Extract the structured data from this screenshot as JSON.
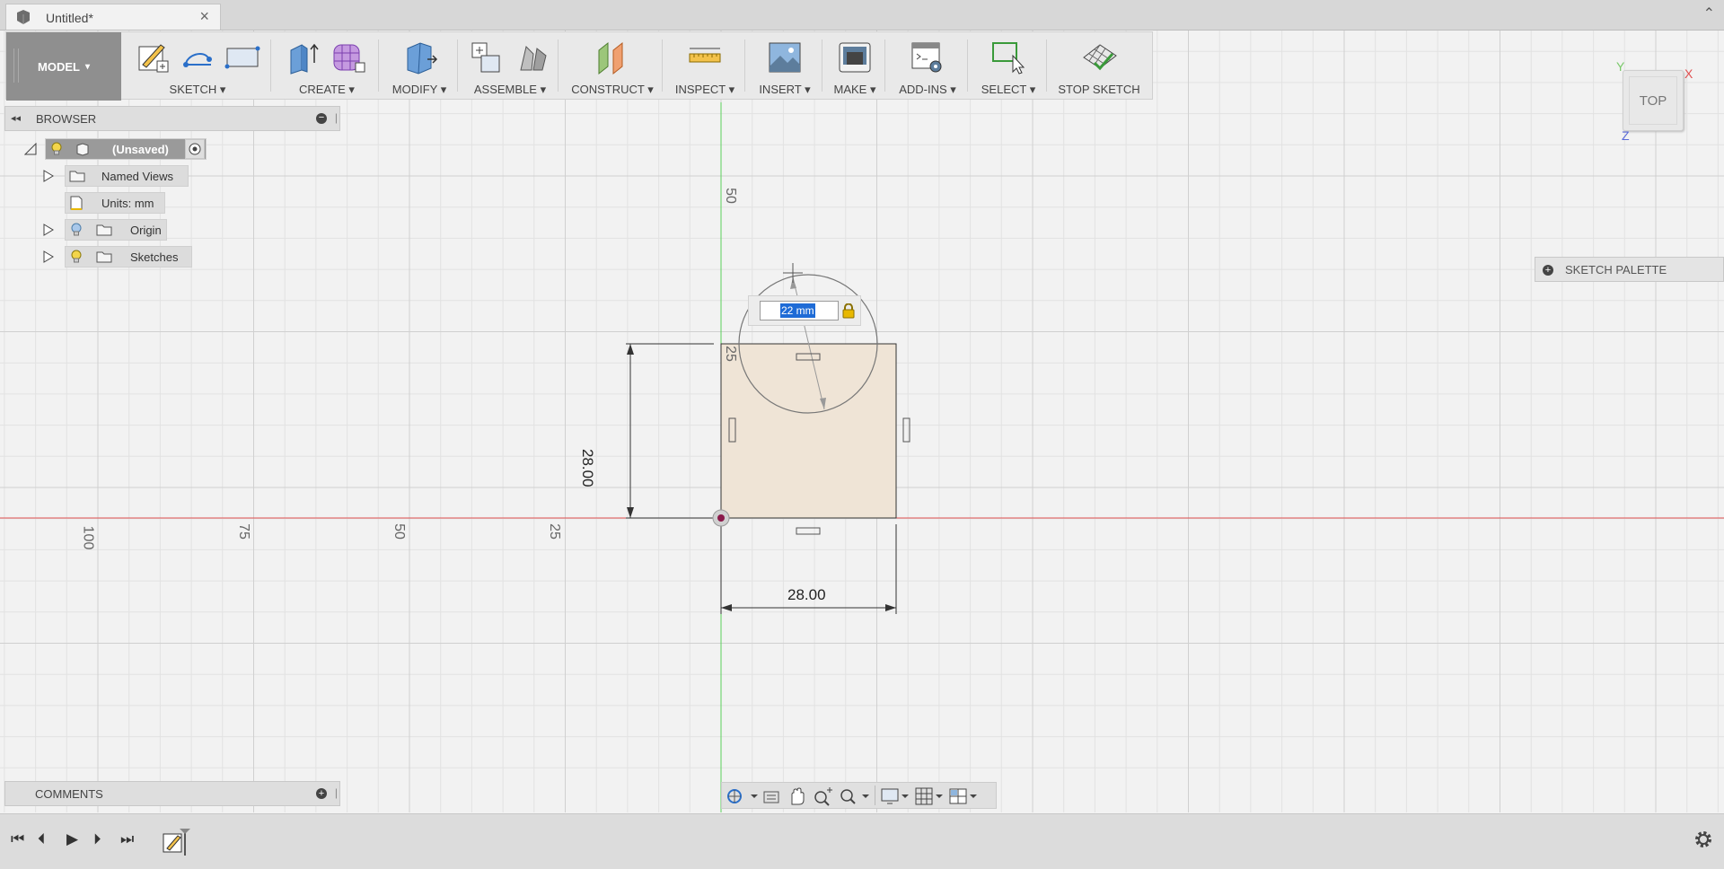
{
  "tab": {
    "title": "Untitled*",
    "close": "×"
  },
  "toolbar": {
    "model_label": "MODEL",
    "groups": [
      {
        "label": "SKETCH"
      },
      {
        "label": "CREATE"
      },
      {
        "label": "MODIFY"
      },
      {
        "label": "ASSEMBLE"
      },
      {
        "label": "CONSTRUCT"
      },
      {
        "label": "INSPECT"
      },
      {
        "label": "INSERT"
      },
      {
        "label": "MAKE"
      },
      {
        "label": "ADD-INS"
      },
      {
        "label": "SELECT"
      },
      {
        "label": "STOP SKETCH"
      }
    ],
    "dropdown_glyph": "▾"
  },
  "browser": {
    "title": "BROWSER",
    "root": "(Unsaved)",
    "items": [
      {
        "label": "Named Views"
      },
      {
        "label": "Units: mm"
      },
      {
        "label": "Origin"
      },
      {
        "label": "Sketches"
      }
    ]
  },
  "comments": {
    "title": "COMMENTS"
  },
  "sketch_palette": {
    "title": "SKETCH PALETTE"
  },
  "viewcube": {
    "face": "TOP",
    "axis_x": "X",
    "axis_y": "Y",
    "axis_z": "Z"
  },
  "canvas": {
    "ruler_left": [
      "100",
      "75",
      "50",
      "25"
    ],
    "ruler_up": [
      "50",
      "25"
    ],
    "dim_width": "28.00",
    "dim_height": "28.00",
    "dim_input_value": "22 mm"
  },
  "colors": {
    "x_axis": "#e05050",
    "y_axis": "#5ad05a",
    "sketch_fill": "#efe4d6",
    "grid": "#d8d8d8",
    "accent": "#1e6bd6"
  }
}
